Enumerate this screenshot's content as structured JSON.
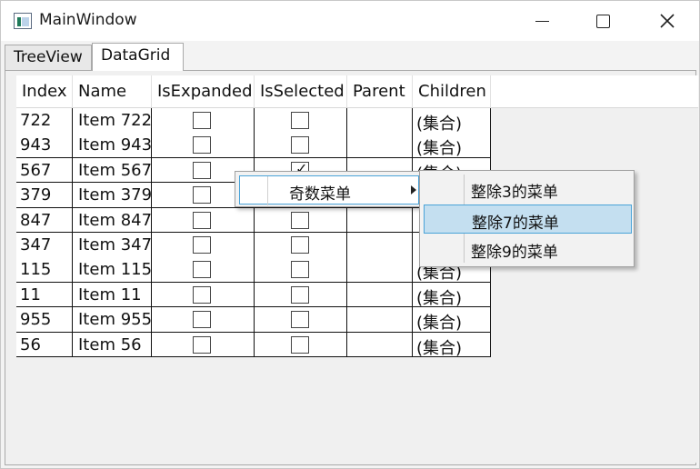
{
  "window": {
    "title": "MainWindow"
  },
  "tabs": [
    {
      "label": "TreeView",
      "selected": false
    },
    {
      "label": "DataGrid",
      "selected": true
    }
  ],
  "grid": {
    "columns": [
      "Index",
      "Name",
      "IsExpanded",
      "IsSelected",
      "Parent",
      "Children"
    ],
    "rows": [
      {
        "index": "722",
        "name": "Item 722",
        "expanded": false,
        "selected": false,
        "parent": "",
        "children": "(集合)"
      },
      {
        "index": "943",
        "name": "Item 943",
        "expanded": false,
        "selected": false,
        "parent": "",
        "children": "(集合)"
      },
      {
        "index": "567",
        "name": "Item 567",
        "expanded": false,
        "selected": true,
        "parent": "",
        "children": "(集合)"
      },
      {
        "index": "379",
        "name": "Item 379",
        "expanded": false,
        "selected": false,
        "parent": "",
        "children": ""
      },
      {
        "index": "847",
        "name": "Item 847",
        "expanded": false,
        "selected": false,
        "parent": "",
        "children": ""
      },
      {
        "index": "347",
        "name": "Item 347",
        "expanded": false,
        "selected": false,
        "parent": "",
        "children": ""
      },
      {
        "index": "115",
        "name": "Item 115",
        "expanded": false,
        "selected": false,
        "parent": "",
        "children": "(集合)"
      },
      {
        "index": "11",
        "name": "Item 11",
        "expanded": false,
        "selected": false,
        "parent": "",
        "children": "(集合)"
      },
      {
        "index": "955",
        "name": "Item 955",
        "expanded": false,
        "selected": false,
        "parent": "",
        "children": "(集合)"
      },
      {
        "index": "56",
        "name": "Item 56",
        "expanded": false,
        "selected": false,
        "parent": "",
        "children": "(集合)"
      }
    ]
  },
  "context_menu": {
    "item": "奇数菜单",
    "submenu": [
      {
        "label": "整除3的菜单",
        "highlighted": false
      },
      {
        "label": "整除7的菜单",
        "highlighted": true
      },
      {
        "label": "整除9的菜单",
        "highlighted": false
      }
    ]
  },
  "colors": {
    "highlight": "#c4dff0",
    "highlight_border": "#4aa3d8"
  }
}
